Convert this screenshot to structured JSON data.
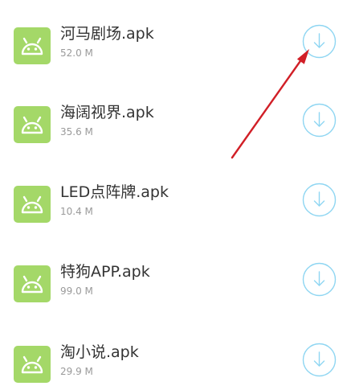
{
  "apps": [
    {
      "name": "河马剧场.apk",
      "size": "52.0 M"
    },
    {
      "name": "海阔视界.apk",
      "size": "35.6 M"
    },
    {
      "name": "LED点阵牌.apk",
      "size": "10.4 M"
    },
    {
      "name": "特狗APP.apk",
      "size": "99.0 M"
    },
    {
      "name": "淘小说.apk",
      "size": "29.9 M"
    }
  ],
  "colors": {
    "icon_bg": "#a4d868",
    "accent": "#8fd6f2",
    "annotation_arrow": "#d11f27"
  },
  "icons": {
    "app": "android-icon",
    "action": "download-icon"
  }
}
